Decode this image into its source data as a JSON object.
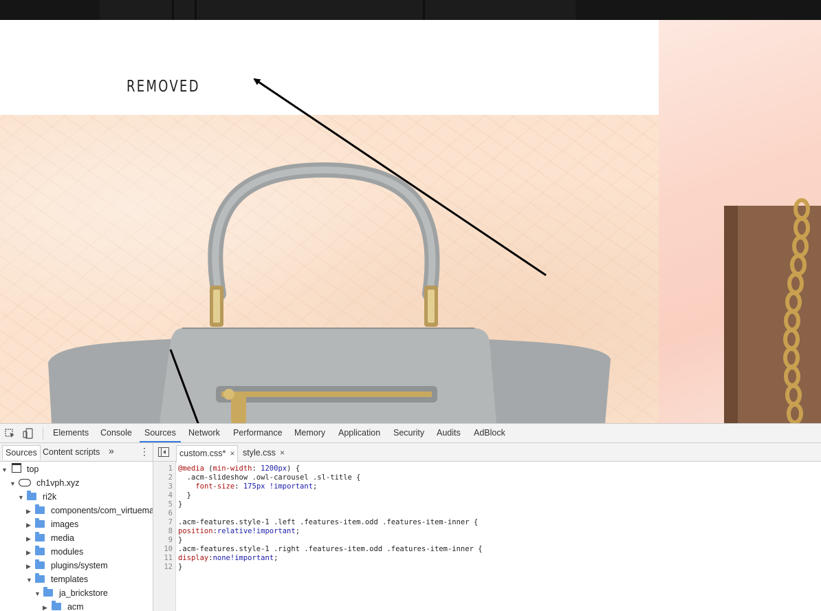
{
  "website": {
    "title": "REMOVED"
  },
  "devtools": {
    "toolbar_icons": [
      "inspect-element-icon",
      "device-toolbar-icon"
    ],
    "main_tabs": [
      {
        "label": "Elements",
        "active": false
      },
      {
        "label": "Console",
        "active": false
      },
      {
        "label": "Sources",
        "active": true
      },
      {
        "label": "Network",
        "active": false
      },
      {
        "label": "Performance",
        "active": false
      },
      {
        "label": "Memory",
        "active": false
      },
      {
        "label": "Application",
        "active": false
      },
      {
        "label": "Security",
        "active": false
      },
      {
        "label": "Audits",
        "active": false
      },
      {
        "label": "AdBlock",
        "active": false
      }
    ],
    "navigator": {
      "tabs": [
        {
          "label": "Sources",
          "active": true
        },
        {
          "label": "Content scripts",
          "active": false
        }
      ],
      "more": "»",
      "menu": "⋮",
      "tree": [
        {
          "label": "top",
          "expanded": true,
          "icon": "frame-icon"
        },
        {
          "label": "ch1vph.xyz",
          "expanded": true,
          "icon": "cloud-icon"
        },
        {
          "label": "ri2k",
          "expanded": true,
          "icon": "folder-icon"
        },
        {
          "label": "components/com_virtuemart",
          "expanded": false,
          "icon": "folder-icon"
        },
        {
          "label": "images",
          "expanded": false,
          "icon": "folder-icon"
        },
        {
          "label": "media",
          "expanded": false,
          "icon": "folder-icon"
        },
        {
          "label": "modules",
          "expanded": false,
          "icon": "folder-icon"
        },
        {
          "label": "plugins/system",
          "expanded": false,
          "icon": "folder-icon"
        },
        {
          "label": "templates",
          "expanded": true,
          "icon": "folder-icon"
        },
        {
          "label": "ja_brickstore",
          "expanded": true,
          "icon": "folder-icon"
        },
        {
          "label": "acm",
          "expanded": false,
          "icon": "folder-icon"
        }
      ]
    },
    "editor": {
      "tabs": [
        {
          "label": "custom.css*",
          "active": true,
          "close": "×"
        },
        {
          "label": "style.css",
          "active": false,
          "close": "×"
        }
      ],
      "line_numbers": [
        "1",
        "2",
        "3",
        "4",
        "5",
        "6",
        "7",
        "8",
        "9",
        "10",
        "11",
        "12"
      ],
      "lines": [
        [
          {
            "t": "@media",
            "c": "k-at"
          },
          {
            "t": " (",
            "c": "k-sel"
          },
          {
            "t": "min-width",
            "c": "k-prop"
          },
          {
            "t": ": ",
            "c": "k-sel"
          },
          {
            "t": "1200px",
            "c": "k-val"
          },
          {
            "t": ") {",
            "c": "k-sel"
          }
        ],
        [
          {
            "t": "  .acm-slideshow .owl-carousel .sl-title {",
            "c": "k-sel"
          }
        ],
        [
          {
            "t": "    ",
            "c": "k-sel"
          },
          {
            "t": "font-size",
            "c": "k-prop"
          },
          {
            "t": ": ",
            "c": "k-sel"
          },
          {
            "t": "175px",
            "c": "k-val"
          },
          {
            "t": " ",
            "c": "k-sel"
          },
          {
            "t": "!important",
            "c": "k-imp"
          },
          {
            "t": ";",
            "c": "k-sel"
          }
        ],
        [
          {
            "t": "  }",
            "c": "k-sel"
          }
        ],
        [
          {
            "t": "}",
            "c": "k-sel"
          }
        ],
        [
          {
            "t": "",
            "c": "k-sel"
          }
        ],
        [
          {
            "t": ".acm-features.style-1 .left .features-item.odd .features-item-inner {",
            "c": "k-sel"
          }
        ],
        [
          {
            "t": "position",
            "c": "k-prop"
          },
          {
            "t": ":",
            "c": "k-sel"
          },
          {
            "t": "relative",
            "c": "k-val"
          },
          {
            "t": "!important",
            "c": "k-imp"
          },
          {
            "t": ";",
            "c": "k-sel"
          }
        ],
        [
          {
            "t": "}",
            "c": "k-sel"
          }
        ],
        [
          {
            "t": ".acm-features.style-1 .right .features-item.odd .features-item-inner {",
            "c": "k-sel"
          }
        ],
        [
          {
            "t": "display",
            "c": "k-prop"
          },
          {
            "t": ":",
            "c": "k-sel"
          },
          {
            "t": "none",
            "c": "k-val"
          },
          {
            "t": "!important",
            "c": "k-imp"
          },
          {
            "t": ";",
            "c": "k-sel"
          }
        ],
        [
          {
            "t": "}",
            "c": "k-sel"
          }
        ]
      ]
    }
  },
  "colors": {
    "devtools_accent": "#3879d9",
    "folder": "#5f9ce6",
    "hero_bg": "#fbe3cf",
    "bag_gray": "#a8acad"
  }
}
